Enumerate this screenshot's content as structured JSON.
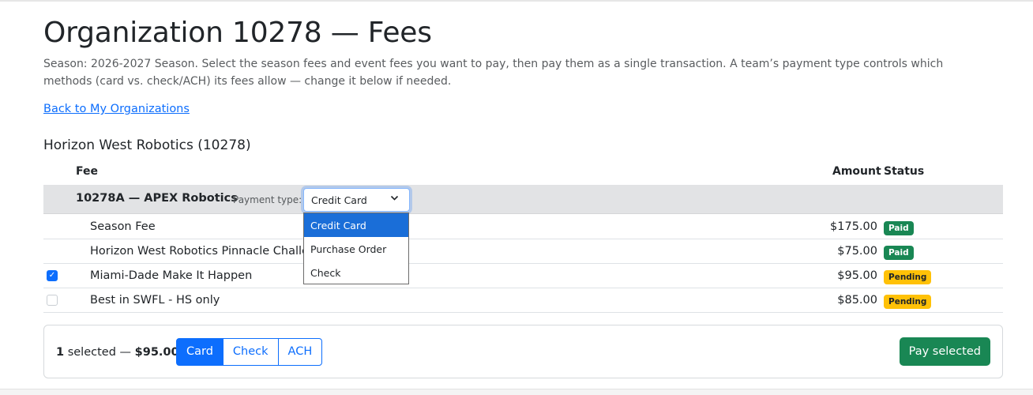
{
  "page": {
    "title": "Organization 10278 — Fees",
    "description": "Season: 2026-2027 Season. Select the season fees and event fees you want to pay, then pay them as a single transaction. A team’s payment type controls which methods (card vs. check/ACH) its fees allow — change it below if needed.",
    "back_link": "Back to My Organizations"
  },
  "organization": {
    "name": "Horizon West Robotics (10278)"
  },
  "table": {
    "headers": {
      "fee": "Fee",
      "amount": "Amount",
      "status": "Status"
    },
    "team": {
      "name": "10278A — APEX Robotics",
      "payment_type_label": "Payment type:",
      "payment_type_value": "Credit Card",
      "payment_type_options": [
        "Credit Card",
        "Purchase Order",
        "Check"
      ],
      "dropdown_open": true
    },
    "rows": [
      {
        "fee": "Season Fee",
        "amount": "$175.00",
        "status": "Paid",
        "checkbox": "none"
      },
      {
        "fee": "Horizon West Robotics Pinnacle Challenge",
        "amount": "$75.00",
        "status": "Paid",
        "checkbox": "none"
      },
      {
        "fee": "Miami-Dade Make It Happen",
        "amount": "$95.00",
        "status": "Pending",
        "checkbox": "checked"
      },
      {
        "fee": "Best in SWFL - HS only",
        "amount": "$85.00",
        "status": "Pending",
        "checkbox": "unchecked"
      }
    ]
  },
  "footer": {
    "selected_count": "1",
    "selected_text": "selected —",
    "selected_total": "$95.00",
    "methods": [
      "Card",
      "Check",
      "ACH"
    ],
    "active_method": "Card",
    "pay_button": "Pay selected"
  },
  "colors": {
    "primary": "#0d6efd",
    "success": "#198754",
    "warning": "#ffc107",
    "group_row": "#e2e3e5"
  }
}
